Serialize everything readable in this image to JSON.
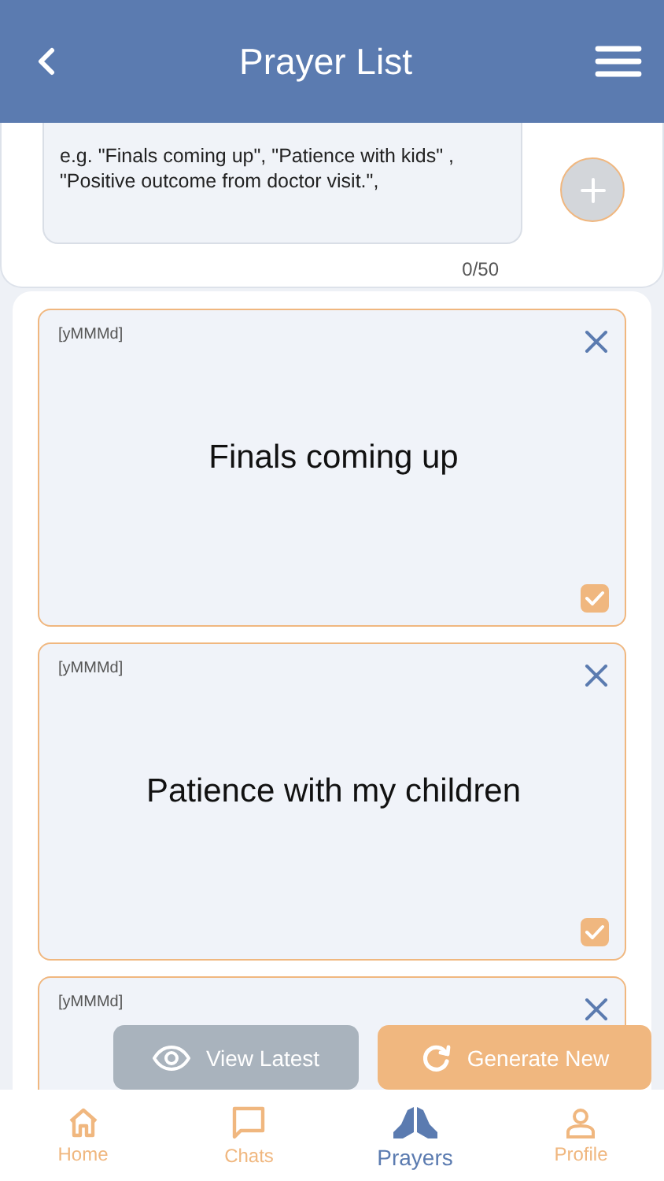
{
  "header": {
    "title": "Prayer List"
  },
  "composer": {
    "placeholder": "e.g. \"Finals coming up\", \"Patience with kids\" , \"Positive outcome from doctor visit.\",",
    "counter": "0/50"
  },
  "prayers": [
    {
      "date": "[yMMMd]",
      "text": "Finals coming up",
      "checked": true
    },
    {
      "date": "[yMMMd]",
      "text": "Patience with my children",
      "checked": true
    },
    {
      "date": "[yMMMd]"
    }
  ],
  "actions": [
    {
      "kind": "view",
      "label": "View Latest",
      "disabled": true
    },
    {
      "kind": "generate",
      "label": "Generate New",
      "disabled": false
    }
  ],
  "nav": [
    {
      "kind": "home",
      "label": "Home",
      "selected": false
    },
    {
      "kind": "chats",
      "label": "Chats",
      "selected": false
    },
    {
      "kind": "prayers",
      "label": "Prayers",
      "selected": true
    },
    {
      "kind": "profile",
      "label": "Profile",
      "selected": false
    }
  ]
}
